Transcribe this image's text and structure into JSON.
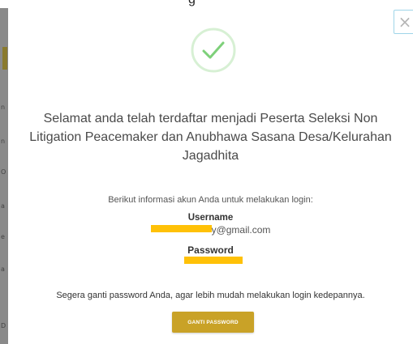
{
  "page": {
    "top_text": "g"
  },
  "modal": {
    "close_label": "×",
    "headline": "Selamat anda telah terdaftar menjadi Peserta Seleksi Non Litigation Peacemaker dan Anubhawa Sasana Desa/Kelurahan Jagadhita",
    "info_intro": "Berikut informasi akun Anda untuk melakukan login:",
    "username_label": "Username",
    "username_value_visible": "y@gmail.com",
    "password_label": "Password",
    "note": "Segera ganti password Anda, agar lebih mudah melakukan login kedepannya.",
    "change_password_button": "GANTI PASSWORD"
  },
  "icons": {
    "success": "check-circle-icon",
    "close": "close-icon"
  },
  "colors": {
    "success_green": "#7ed07a",
    "success_ring": "#d7f0d4",
    "button_gold": "#c9a227",
    "redaction_yellow": "#ffc107",
    "overlay_gray": "#7a7a7a"
  }
}
